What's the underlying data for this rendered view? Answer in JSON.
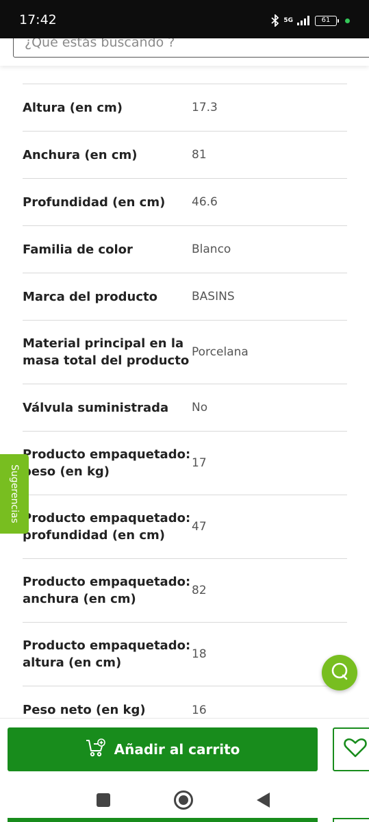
{
  "status_bar": {
    "time": "17:42",
    "network": "5G",
    "battery": "61",
    "icons": [
      "bluetooth-icon",
      "signal-icon",
      "battery-icon"
    ]
  },
  "search": {
    "placeholder": "¿Qué estás buscando ?"
  },
  "specs": [
    {
      "label": "Altura (en cm)",
      "value": "17.3"
    },
    {
      "label": "Anchura (en cm)",
      "value": "81"
    },
    {
      "label": "Profundidad (en cm)",
      "value": "46.6"
    },
    {
      "label": "Familia de color",
      "value": "Blanco"
    },
    {
      "label": "Marca del producto",
      "value": "BASINS"
    },
    {
      "label": "Material principal en la masa total del producto",
      "value": "Porcelana"
    },
    {
      "label": "Válvula suministrada",
      "value": "No"
    },
    {
      "label": "Producto empaquetado: peso (en kg)",
      "value": "17"
    },
    {
      "label": "Producto empaquetado: profundidad (en cm)",
      "value": "47"
    },
    {
      "label": "Producto empaquetado: anchura (en cm)",
      "value": "82"
    },
    {
      "label": "Producto empaquetado: altura (en cm)",
      "value": "18"
    },
    {
      "label": "Peso neto (en kg)",
      "value": "16"
    }
  ],
  "side_tab": {
    "label": "Sugerencias"
  },
  "actions": {
    "add_to_cart_label": "Añadir al carrito"
  },
  "colors": {
    "brand_green": "#188c1c",
    "accent_green": "#78be20"
  }
}
